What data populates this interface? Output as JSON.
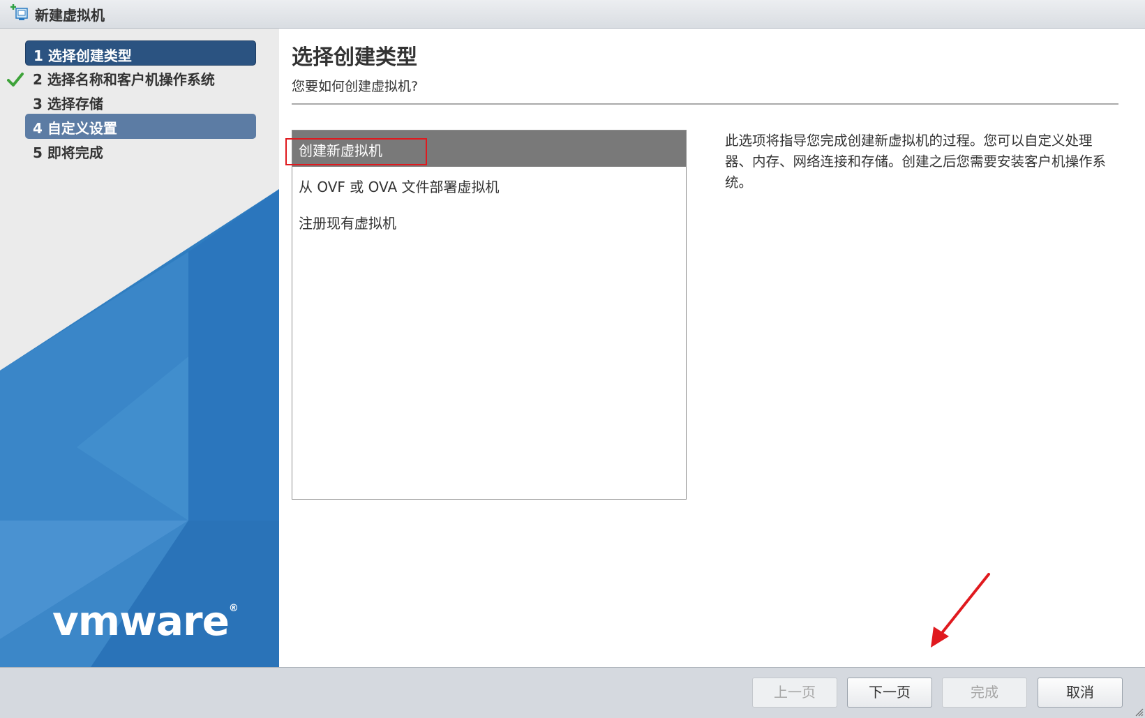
{
  "window": {
    "title": "新建虚拟机"
  },
  "steps": [
    {
      "label": "1 选择创建类型",
      "state": "current"
    },
    {
      "label": "2 选择名称和客户机操作系统",
      "state": "pending"
    },
    {
      "label": "3 选择存储",
      "state": "pending"
    },
    {
      "label": "4 自定义设置",
      "state": "hover"
    },
    {
      "label": "5 即将完成",
      "state": "pending"
    }
  ],
  "brand": {
    "logo_text": "vmware",
    "registered_mark": "®",
    "colors": {
      "blue": "#2a7ac2",
      "nav_active": "#2b5381"
    }
  },
  "content": {
    "title": "选择创建类型",
    "subtitle": "您要如何创建虚拟机?",
    "options": [
      {
        "label": "创建新虚拟机",
        "selected": true
      },
      {
        "label": "从 OVF 或 OVA 文件部署虚拟机",
        "selected": false
      },
      {
        "label": "注册现有虚拟机",
        "selected": false
      }
    ],
    "description": "此选项将指导您完成创建新虚拟机的过程。您可以自定义处理器、内存、网络连接和存储。创建之后您需要安装客户机操作系统。"
  },
  "footer": {
    "buttons": [
      {
        "label": "上一页",
        "enabled": false
      },
      {
        "label": "下一页",
        "enabled": true
      },
      {
        "label": "完成",
        "enabled": false
      },
      {
        "label": "取消",
        "enabled": true
      }
    ]
  },
  "icons": {
    "window": "new-vm-icon",
    "check": "checkmark-icon",
    "grip": "resize-grip-icon"
  }
}
